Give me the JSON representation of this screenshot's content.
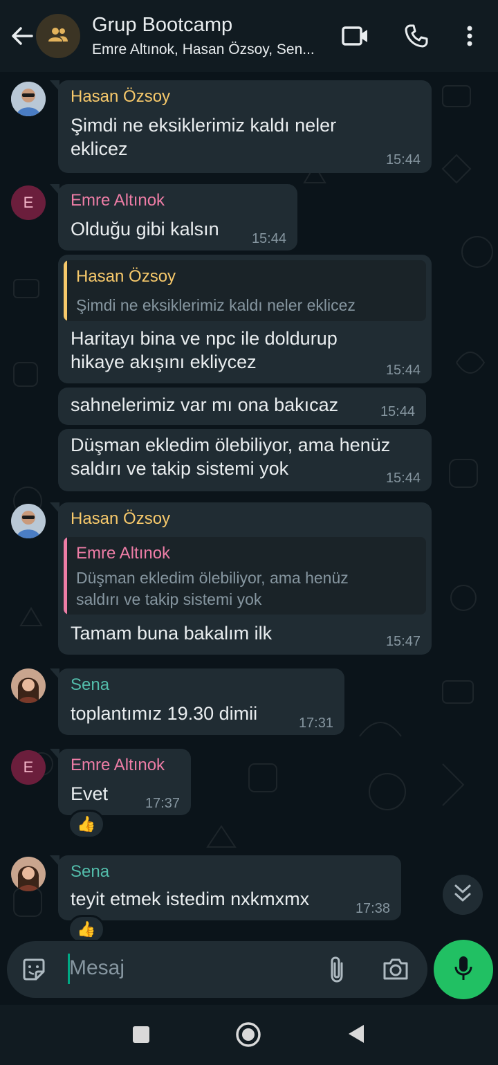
{
  "header": {
    "title": "Grup Bootcamp",
    "subtitle": "Emre Altınok, Hasan Özsoy, Sen..."
  },
  "messages": [
    {
      "sender": "Hasan Özsoy",
      "text_lines": [
        "Şimdi ne eksiklerimiz kaldı neler",
        "eklicez"
      ],
      "time": "15:44"
    },
    {
      "sender": "Emre Altınok",
      "avatar_letter": "E",
      "text": "Olduğu gibi kalsın",
      "time": "15:44"
    },
    {
      "quote_sender": "Hasan Özsoy",
      "quote_text": "Şimdi ne eksiklerimiz kaldı neler eklicez",
      "text_lines": [
        "Haritayı bina ve npc ile doldurup",
        "hikaye akışını ekliycez"
      ],
      "time": "15:44"
    },
    {
      "text": "sahnelerimiz var mı ona bakıcaz",
      "time": "15:44"
    },
    {
      "text_lines": [
        "Düşman ekledim ölebiliyor, ama henüz",
        "saldırı ve takip sistemi yok"
      ],
      "time": "15:44"
    },
    {
      "sender": "Hasan Özsoy",
      "quote_sender": "Emre Altınok",
      "quote_lines": [
        "Düşman ekledim ölebiliyor, ama henüz",
        "saldırı ve takip sistemi yok"
      ],
      "text": "Tamam buna bakalım ilk",
      "time": "15:47"
    },
    {
      "sender": "Sena",
      "text": "toplantımız 19.30 dimii",
      "time": "17:31"
    },
    {
      "sender": "Emre Altınok",
      "avatar_letter": "E",
      "text": "Evet",
      "time": "17:37",
      "reaction": "👍"
    },
    {
      "sender": "Sena",
      "text": "teyit etmek istedim nxkmxmx",
      "time": "17:38",
      "reaction": "👍"
    }
  ],
  "input": {
    "placeholder": "Mesaj"
  },
  "colors": {
    "hasan": "#f7c96b",
    "emre": "#ee7da6",
    "sena": "#53bdab",
    "mic_button": "#21c063",
    "bubble": "#202c33",
    "background": "#0b141a"
  },
  "icons": [
    "back-arrow-icon",
    "group-icon",
    "video-call-icon",
    "phone-icon",
    "more-vert-icon",
    "sticker-icon",
    "attach-icon",
    "camera-icon",
    "mic-icon",
    "double-chevron-down-icon",
    "nav-recents-icon",
    "nav-home-icon",
    "nav-back-icon"
  ]
}
